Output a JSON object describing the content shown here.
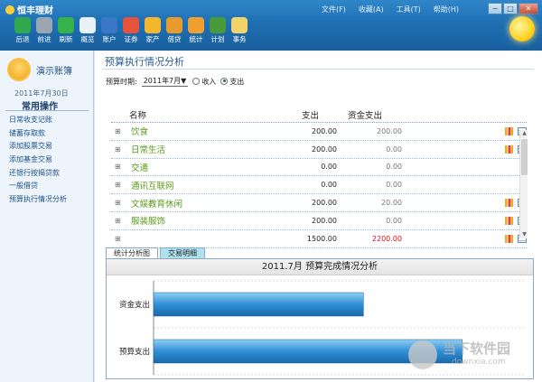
{
  "window": {
    "title": "恒丰理财",
    "menu": [
      "文件(F)",
      "收藏(A)",
      "工具(T)",
      "帮助(H)"
    ],
    "controls": [
      "−",
      "□",
      "✕"
    ]
  },
  "toolbar": {
    "items": [
      {
        "label": "后退",
        "color": "#2fa84f"
      },
      {
        "label": "前进",
        "color": "#9aa7b3"
      },
      {
        "label": "刷新",
        "color": "#35b24a"
      },
      {
        "label": "概览",
        "color": "#e8f0f8"
      },
      {
        "label": "账户",
        "color": "#3a78c7"
      },
      {
        "label": "证券",
        "color": "#e5533c"
      },
      {
        "label": "家产",
        "color": "#f4b62a"
      },
      {
        "label": "借贷",
        "color": "#e79a2d"
      },
      {
        "label": "统计",
        "color": "#f0a030"
      },
      {
        "label": "计划",
        "color": "#4a9a3c"
      },
      {
        "label": "事务",
        "color": "#f2d36b"
      }
    ]
  },
  "sidebar": {
    "account_name": "演示账簿",
    "date": "2011年7月30日",
    "section_title": "常用操作",
    "items": [
      "日常收支记账",
      "储蓄存取款",
      "添加股票交易",
      "添加基金交易",
      "还银行按揭贷款",
      "一般借贷",
      "预算执行情况分析"
    ]
  },
  "main": {
    "title": "预算执行情况分析",
    "filter": {
      "label": "预算时期:",
      "period": "2011年7月▼",
      "radio_income": "收入",
      "radio_expense": "支出",
      "selected": "支出"
    },
    "table": {
      "headers": {
        "name": "名称",
        "out": "支出",
        "fund": "资金支出"
      },
      "rows": [
        {
          "name": "饮食",
          "out": "200.00",
          "fund": "200.00",
          "icons": true,
          "fund_red": false
        },
        {
          "name": "日常生活",
          "out": "200.00",
          "fund": "0.00",
          "icons": true,
          "fund_red": false
        },
        {
          "name": "交通",
          "out": "0.00",
          "fund": "0.00",
          "icons": false,
          "fund_red": false
        },
        {
          "name": "通讯互联网",
          "out": "0.00",
          "fund": "0.00",
          "icons": false,
          "fund_red": false
        },
        {
          "name": "文娱教育休闲",
          "out": "200.00",
          "fund": "20.00",
          "icons": true,
          "fund_red": false
        },
        {
          "name": "服装服饰",
          "out": "200.00",
          "fund": "0.00",
          "icons": true,
          "fund_red": false
        },
        {
          "name": "",
          "out": "1500.00",
          "fund": "2200.00",
          "icons": true,
          "fund_red": true
        }
      ]
    },
    "tabs": [
      "统计分析图",
      "交易明细"
    ],
    "active_tab": "统计分析图"
  },
  "chart_data": {
    "type": "bar",
    "orientation": "horizontal",
    "title": "2011.7月 预算完成情况分析",
    "categories": [
      "资金支出",
      "预算支出"
    ],
    "values": [
      1020,
      1500
    ],
    "xlim": [
      0,
      1800
    ],
    "grid": true,
    "bar_color": "#2f8fd6"
  },
  "watermark": {
    "line1": "当下软件园",
    "line2": "downxia.com"
  }
}
